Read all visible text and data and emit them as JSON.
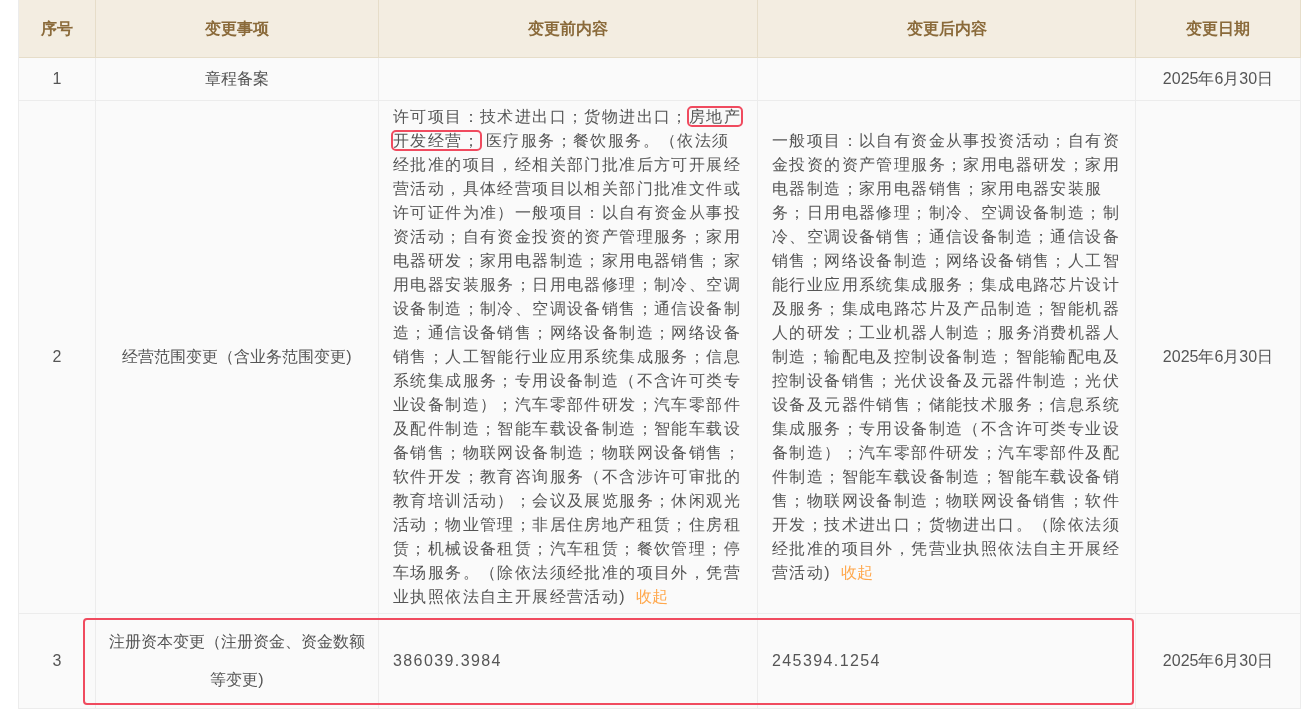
{
  "table": {
    "columns": [
      "序号",
      "变更事项",
      "变更前内容",
      "变更后内容",
      "变更日期"
    ],
    "rows": [
      {
        "index": "1",
        "item": "章程备案",
        "before": [],
        "after": [],
        "date": "2025年6月30日",
        "highlighted": false
      },
      {
        "index": "2",
        "item": "经营范围变更（含业务范围变更)",
        "before": [
          {
            "text": "许可项目：技术进出口；货物进出口；",
            "highlighted": false
          },
          {
            "text": "房地产开发经营；",
            "highlighted": true
          },
          {
            "text": "医疗服务；餐饮服务。（依法须经批准的项目，经相关部门批准后方可开展经营活动，具体经营项目以相关部门批准文件或许可证件为准）一般项目：以自有资金从事投资活动；自有资金投资的资产管理服务；家用电器研发；家用电器制造；家用电器销售；家用电器安装服务；日用电器修理；制冷、空调设备制造；制冷、空调设备销售；通信设备制造；通信设备销售；网络设备制造；网络设备销售；人工智能行业应用系统集成服务；信息系统集成服务；专用设备制造（不含许可类专业设备制造）；汽车零部件研发；汽车零部件及配件制造；智能车载设备制造；智能车载设备销售；物联网设备制造；物联网设备销售；软件开发；教育咨询服务（不含涉许可审批的教育培训活动）；会议及展览服务；休闲观光活动；物业管理；非居住房地产租赁；住房租赁；机械设备租赁；汽车租赁；餐饮管理；停车场服务。（除依法须经批准的项目外，凭营业执照依法自主开展经营活动)",
            "highlighted": false
          }
        ],
        "before_link": "收起",
        "after": [
          {
            "text": "一般项目：以自有资金从事投资活动；自有资金投资的资产管理服务；家用电器研发；家用电器制造；家用电器销售；家用电器安装服务；日用电器修理；制冷、空调设备制造；制冷、空调设备销售；通信设备制造；通信设备销售；网络设备制造；网络设备销售；人工智能行业应用系统集成服务；集成电路芯片设计及服务；集成电路芯片及产品制造；智能机器人的研发；工业机器人制造；服务消费机器人制造；输配电及控制设备制造；智能输配电及控制设备销售；光伏设备及元器件制造；光伏设备及元器件销售；储能技术服务；信息系统集成服务；专用设备制造（不含许可类专业设备制造）；汽车零部件研发；汽车零部件及配件制造；智能车载设备制造；智能车载设备销售；物联网设备制造；物联网设备销售；软件开发；技术进出口；货物进出口。（除依法须经批准的项目外，凭营业执照依法自主开展经营活动)",
            "highlighted": false
          }
        ],
        "after_link": "收起",
        "date": "2025年6月30日",
        "highlighted": false
      },
      {
        "index": "3",
        "item": "注册资本变更（注册资金、资金数额等变更)",
        "before": [
          {
            "text": "386039.3984",
            "highlighted": false
          }
        ],
        "after": [
          {
            "text": "245394.1254",
            "highlighted": false
          }
        ],
        "date": "2025年6月30日",
        "highlighted": true
      }
    ]
  }
}
